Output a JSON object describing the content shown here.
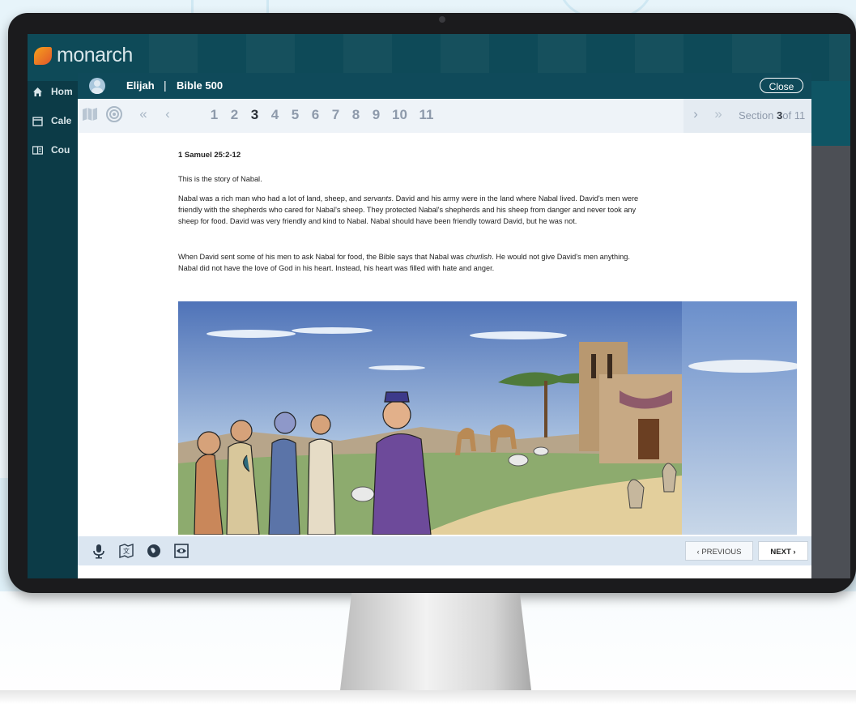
{
  "app": {
    "brand": "monarch",
    "sidebar": [
      {
        "label": "Hom",
        "icon": "home-icon"
      },
      {
        "label": "Cale",
        "icon": "calendar-icon"
      },
      {
        "label": "Cou",
        "icon": "courses-icon"
      }
    ]
  },
  "header": {
    "student": "Elijah",
    "separator": "|",
    "course": "Bible 500",
    "close_label": "Close"
  },
  "toolbar": {
    "pages": [
      "1",
      "2",
      "3",
      "4",
      "5",
      "6",
      "7",
      "8",
      "9",
      "10",
      "11"
    ],
    "active_page": "3",
    "section_prefix": "Section",
    "section_current": "3",
    "section_suffix": "of 11",
    "icons": [
      "map-icon",
      "target-icon",
      "double-left-icon",
      "left-icon",
      "right-icon",
      "double-right-icon"
    ]
  },
  "lesson": {
    "reference": "1 Samuel 25:2-12",
    "p1": "This is the story of Nabal.",
    "p2_a": "Nabal was a rich man who had a lot of land, sheep, and ",
    "p2_em": "servants",
    "p2_b": ". David and his army were in the land where Nabal lived. David's men were friendly with the shepherds who cared for Nabal's sheep. They protected Nabal's shepherds and his sheep from danger and never took any sheep for food. David was very friendly and kind to Nabal. Nabal should have been friendly toward David, but he was not.",
    "p3_a": "When David sent some of his men to ask Nabal for food, the Bible says that Nabal was ",
    "p3_em": "churlish",
    "p3_b": ". He would not give David's men anything. Nabal did not have the love of God in his heart. Instead, his heart was filled with hate and anger."
  },
  "footer": {
    "tools": [
      "microphone-icon",
      "translate-icon",
      "globe-icon",
      "eye-icon"
    ],
    "prev_label": "‹  PREVIOUS",
    "next_label": "NEXT  ›"
  },
  "colors": {
    "header": "#0f4a5a",
    "sidebar": "#0c3b47",
    "toolbar": "#eef3f8",
    "footer": "#dbe6f1"
  }
}
